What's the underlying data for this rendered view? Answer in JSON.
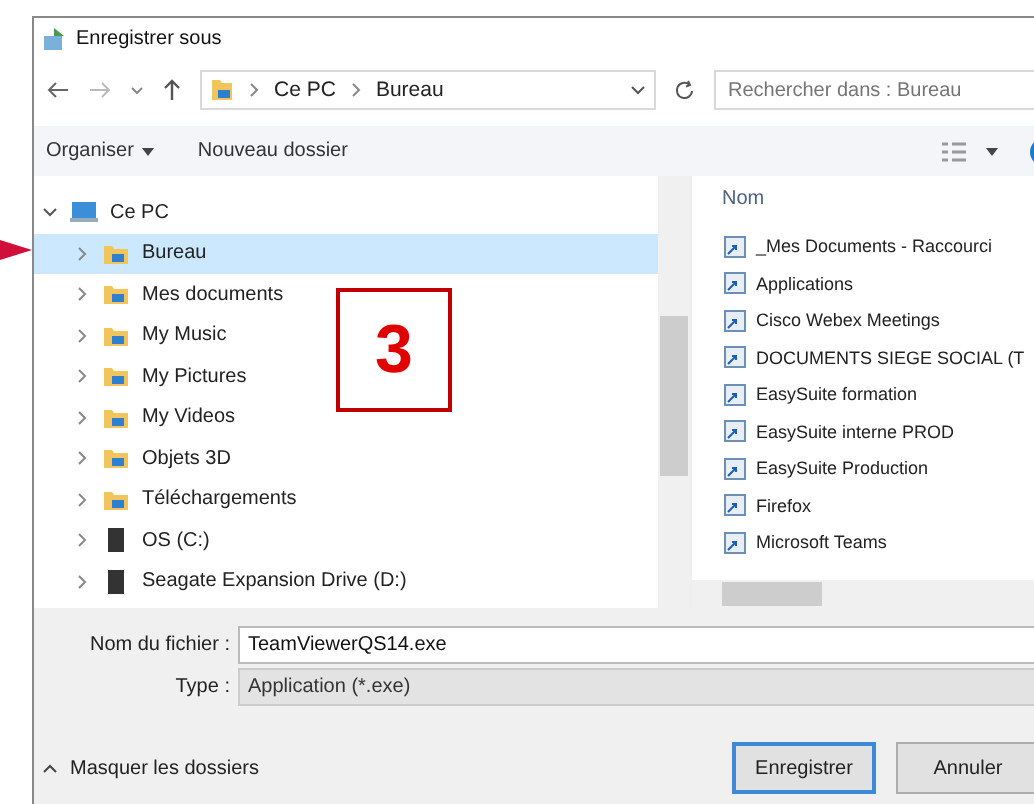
{
  "window": {
    "title": "Enregistrer sous"
  },
  "address": {
    "path": [
      "Ce PC",
      "Bureau"
    ]
  },
  "search": {
    "placeholder": "Rechercher dans : Bureau"
  },
  "toolbar": [
    {
      "label": "Organiser",
      "dropdown": true
    },
    {
      "label": "Nouveau dossier",
      "dropdown": false
    }
  ],
  "tree": [
    {
      "label": "Ce PC",
      "kind": "computer",
      "expanded": true,
      "selected": false,
      "children": [
        {
          "label": "Bureau",
          "kind": "folder",
          "expanded": false,
          "selected": true
        },
        {
          "label": "Mes documents",
          "kind": "folder",
          "expanded": false,
          "selected": false
        },
        {
          "label": "My Music",
          "kind": "folder",
          "expanded": false,
          "selected": false
        },
        {
          "label": "My Pictures",
          "kind": "folder",
          "expanded": false,
          "selected": false
        },
        {
          "label": "My Videos",
          "kind": "folder",
          "expanded": false,
          "selected": false
        },
        {
          "label": "Objets 3D",
          "kind": "folder",
          "expanded": false,
          "selected": false
        },
        {
          "label": "Téléchargements",
          "kind": "folder",
          "expanded": false,
          "selected": false
        },
        {
          "label": "OS (C:)",
          "kind": "drive",
          "expanded": false,
          "selected": false
        },
        {
          "label": "Seagate Expansion Drive (D:)",
          "kind": "drive",
          "expanded": false,
          "selected": false
        }
      ]
    }
  ],
  "files": {
    "column": "Nom",
    "rows": [
      "_Mes Documents - Raccourci",
      "Applications",
      "Cisco Webex Meetings",
      "DOCUMENTS SIEGE SOCIAL (T",
      "EasySuite formation",
      "EasySuite interne PROD",
      "EasySuite Production",
      "Firefox",
      "Microsoft Teams"
    ]
  },
  "filename": {
    "label": "Nom du fichier :",
    "value": "TeamViewerQS14.exe"
  },
  "filetype": {
    "label": "Type :",
    "value": "Application (*.exe)"
  },
  "hide_folders": "Masquer les dossiers",
  "buttons": [
    {
      "label": "Enregistrer",
      "default": true
    },
    {
      "label": "Annuler",
      "default": false
    }
  ],
  "annotation": {
    "label": "3"
  }
}
